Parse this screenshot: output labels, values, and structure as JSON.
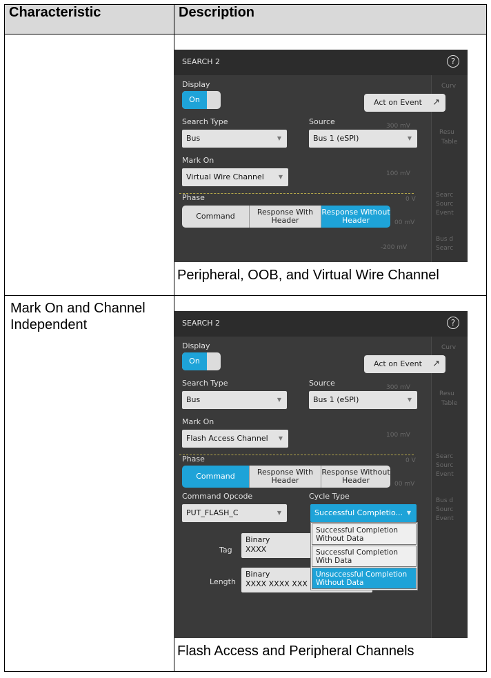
{
  "table": {
    "headers": [
      "Characteristic",
      "Description"
    ],
    "row1": {
      "characteristic": "",
      "caption": "Peripheral, OOB, and Virtual Wire Channel"
    },
    "row2": {
      "characteristic": "Mark On and Channel Independent",
      "caption": "Flash Access and Peripheral Channels"
    }
  },
  "panel1": {
    "title": "SEARCH 2",
    "help_icon": "?",
    "display_label": "Display",
    "toggle_label": "On",
    "act_on_event": "Act on Event",
    "search_type_label": "Search Type",
    "search_type_value": "Bus",
    "source_label": "Source",
    "source_value": "Bus 1 (eSPI)",
    "mark_on_label": "Mark On",
    "mark_on_value": "Virtual Wire Channel",
    "phase_label": "Phase",
    "phase_options": [
      "Command",
      "Response With Header",
      "Response Without Header"
    ],
    "phase_selected": 2,
    "ghost": [
      "Curv",
      "300 mV",
      "Resu",
      "Table",
      "100 mV",
      "Searc",
      "Sourc",
      "Event",
      "0 V",
      "00 mV",
      "Bus d",
      "Searc",
      "-200 mV"
    ]
  },
  "panel2": {
    "title": "SEARCH 2",
    "help_icon": "?",
    "display_label": "Display",
    "toggle_label": "On",
    "act_on_event": "Act on Event",
    "search_type_label": "Search Type",
    "search_type_value": "Bus",
    "source_label": "Source",
    "source_value": "Bus 1 (eSPI)",
    "mark_on_label": "Mark On",
    "mark_on_value": "Flash Access Channel",
    "phase_label": "Phase",
    "phase_options": [
      "Command",
      "Response With Header",
      "Response Without Header"
    ],
    "phase_selected": 0,
    "command_opcode_label": "Command Opcode",
    "command_opcode_value": "PUT_FLASH_C",
    "cycle_type_label": "Cycle Type",
    "cycle_type_value": "Successful Completio...",
    "cycle_type_options": [
      "Successful Completion Without Data",
      "Successful Completion With Data",
      "Unsuccessful Completion Without Data"
    ],
    "cycle_type_highlight": 2,
    "tag_label": "Tag",
    "tag_format": "Binary",
    "tag_value": "XXXX",
    "length_label": "Length",
    "length_format": "Binary",
    "length_value": "XXXX XXXX XXX",
    "ghost": [
      "Curv",
      "300 mV",
      "Resu",
      "Table",
      "100 mV",
      "Searc",
      "Sourc",
      "Event",
      "0 V",
      "00 mV",
      "Bus d",
      "Sourc",
      "Event"
    ]
  },
  "colors": {
    "accent": "#1ea3d8",
    "panel_bg": "#3a3a3a",
    "header_bg": "#d9d9d9"
  }
}
